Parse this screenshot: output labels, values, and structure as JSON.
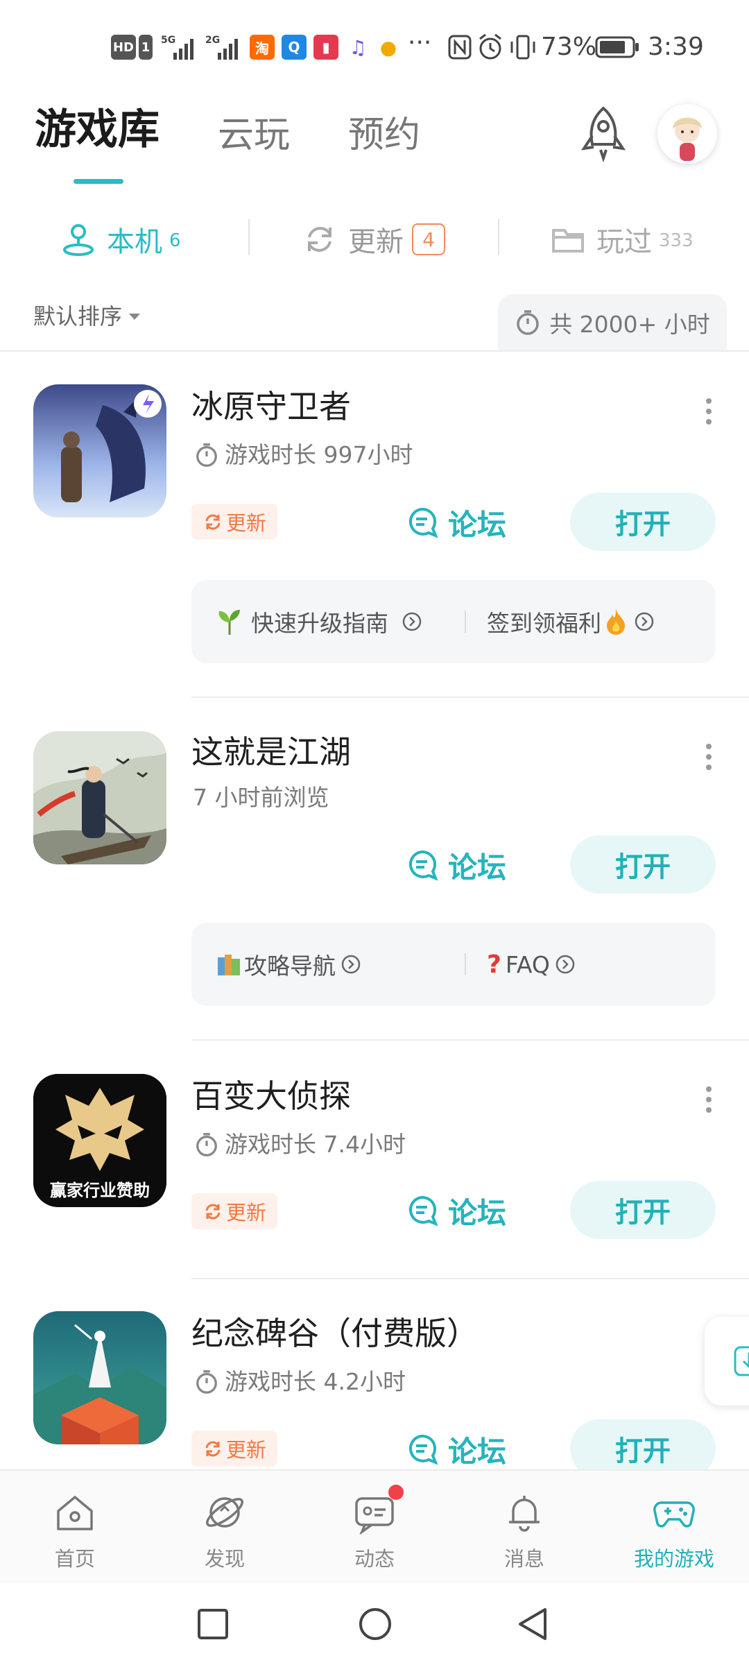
{
  "status_bar": {
    "hd_label": "HD",
    "sim1": "1",
    "net1": "5G",
    "net2": "2G",
    "battery": "73%",
    "time": "3:39",
    "app_icons": [
      "taobao-icon",
      "browser-icon",
      "book-icon",
      "music-icon",
      "game-icon"
    ]
  },
  "header": {
    "tabs": [
      {
        "label": "游戏库",
        "active": true
      },
      {
        "label": "云玩",
        "active": false
      },
      {
        "label": "预约",
        "active": false
      }
    ]
  },
  "sub_tabs": [
    {
      "label": "本机",
      "count": "6",
      "active": true,
      "icon": "phone-icon"
    },
    {
      "label": "更新",
      "count": "4",
      "active": false,
      "icon": "refresh-icon"
    },
    {
      "label": "玩过",
      "count": "333",
      "active": false,
      "icon": "folder-icon"
    }
  ],
  "sort": {
    "label": "默认排序"
  },
  "total_time": "共 2000+ 小时",
  "games": [
    {
      "name": "冰原守卫者",
      "subtitle": "游戏时长 997小时",
      "show_timer": true,
      "update_label": "更新",
      "forum_label": "论坛",
      "open_label": "打开",
      "quick_links": [
        "快速升级指南",
        "签到领福利"
      ]
    },
    {
      "name": "这就是江湖",
      "subtitle": "7 小时前浏览",
      "show_timer": false,
      "update_label": "",
      "forum_label": "论坛",
      "open_label": "打开",
      "quick_links": [
        "攻略导航",
        "FAQ"
      ]
    },
    {
      "name": "百变大侦探",
      "subtitle": "游戏时长 7.4小时",
      "show_timer": true,
      "update_label": "更新",
      "forum_label": "论坛",
      "open_label": "打开",
      "icon_caption": "赢家行业赞助"
    },
    {
      "name": "纪念碑谷（付费版）",
      "subtitle": "游戏时长 4.2小时",
      "show_timer": true,
      "update_label": "更新",
      "forum_label": "论坛",
      "open_label": "打开"
    }
  ],
  "bottom_nav": [
    {
      "label": "首页",
      "icon": "home-icon",
      "active": false
    },
    {
      "label": "发现",
      "icon": "planet-icon",
      "active": false
    },
    {
      "label": "动态",
      "icon": "chat-icon",
      "active": false,
      "dot": true
    },
    {
      "label": "消息",
      "icon": "bell-icon",
      "active": false
    },
    {
      "label": "我的游戏",
      "icon": "gamepad-icon",
      "active": true
    }
  ],
  "colors": {
    "accent": "#2bbcc4",
    "update": "#f07a45",
    "badge_dot": "#f0404a"
  }
}
